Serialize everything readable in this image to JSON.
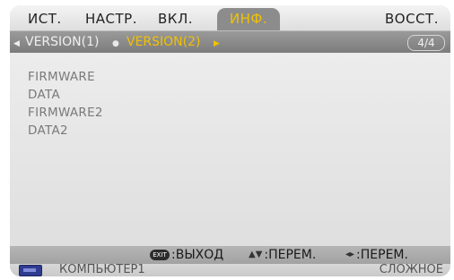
{
  "tabs": [
    {
      "label": "ИСТ."
    },
    {
      "label": "НАСТР."
    },
    {
      "label": "ВКЛ."
    },
    {
      "label": "ИНФ."
    },
    {
      "label": "ВОССТ."
    }
  ],
  "subtabs": {
    "prev_label": "VERSION(1)",
    "current_label": "VERSION(2)",
    "page": "4/4"
  },
  "rows": [
    "FIRMWARE",
    "DATA",
    "FIRMWARE2",
    "DATA2"
  ],
  "hints": {
    "exit_icon": "EXIT",
    "exit": ":ВЫХОД",
    "move_vertical": ":ПЕРЕМ.",
    "move_horizontal": ":ПЕРЕМ."
  },
  "status": {
    "source": "КОМПЬЮТЕР1",
    "menu_mode": "СЛОЖНОЕ"
  },
  "colors": {
    "active_tab_bg": "#8c8c8c",
    "active_text": "#f2c100"
  }
}
